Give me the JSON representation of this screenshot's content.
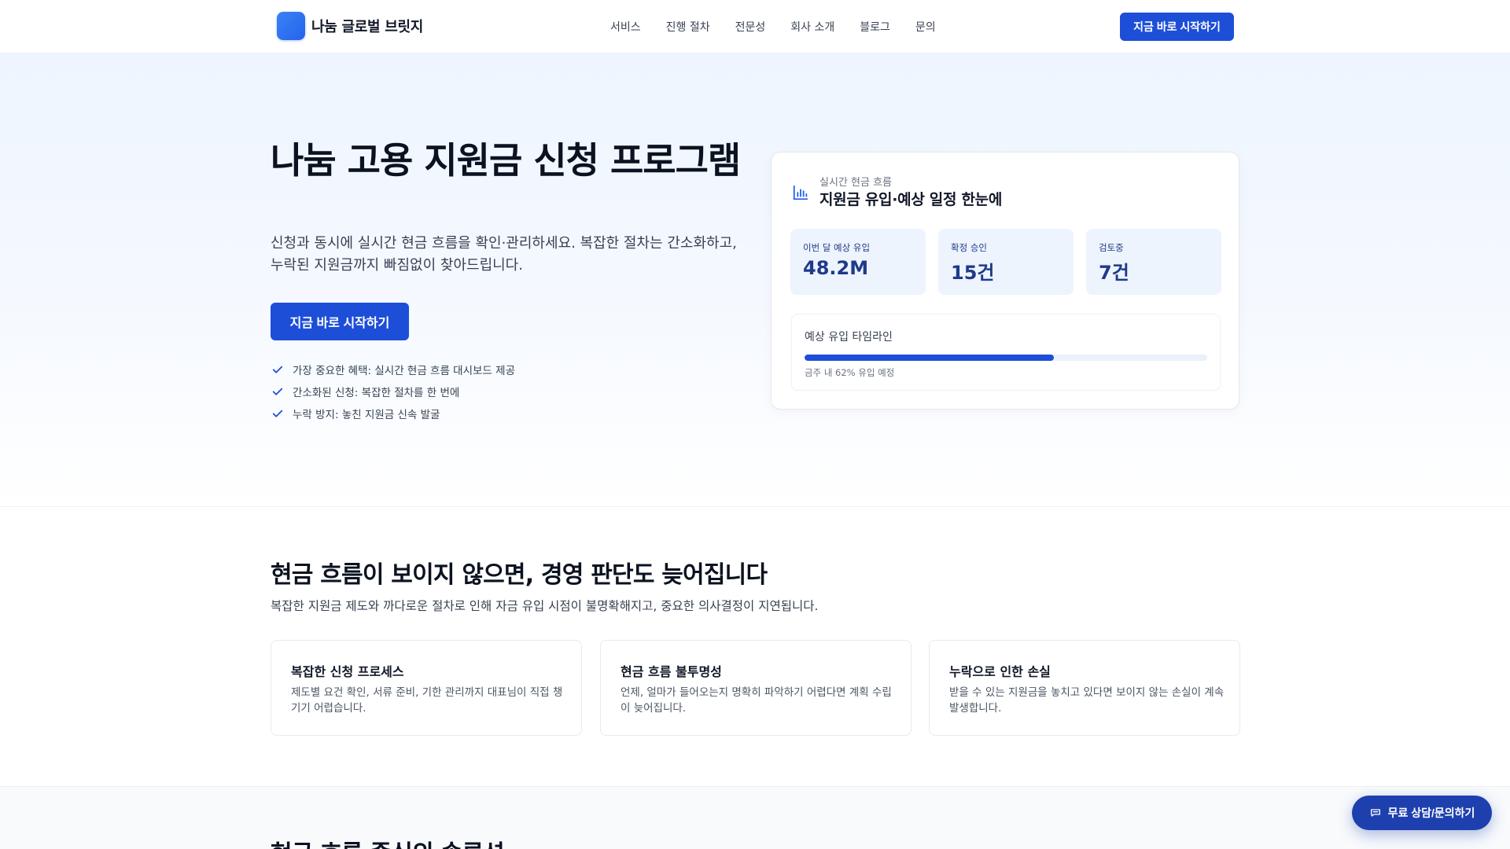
{
  "header": {
    "brand": "나눔 글로벌 브릿지",
    "nav": [
      "서비스",
      "진행 절차",
      "전문성",
      "회사 소개",
      "블로그",
      "문의"
    ],
    "cta_label": "지금 바로 시작하기"
  },
  "hero": {
    "title": "나눔 고용 지원금 신청 프로그램",
    "description": "신청과 동시에 실시간 현금 흐름을 확인·관리하세요. 복잡한 절차는 간소화하고, 누락된 지원금까지 빠짐없이 찾아드립니다.",
    "cta_label": "지금 바로 시작하기",
    "benefits": [
      "가장 중요한 혜택: 실시간 현금 흐름 대시보드 제공",
      "간소화된 신청: 복잡한 절차를 한 번에",
      "누락 방지: 놓친 지원금 신속 발굴"
    ]
  },
  "dashboard": {
    "icon": "bar-chart-icon",
    "subtitle": "실시간 현금 흐름",
    "title": "지원금 유입·예상 일정 한눈에",
    "stats": [
      {
        "label": "이번 달 예상 유입",
        "value": "48.2M"
      },
      {
        "label": "확정 승인",
        "value": "15건"
      },
      {
        "label": "검토중",
        "value": "7건"
      }
    ],
    "timeline": {
      "label": "예상 유입 타임라인",
      "progress_percent": 62,
      "note": "금주 내 62% 유입 예정"
    }
  },
  "problem": {
    "title": "현금 흐름이 보이지 않으면, 경영 판단도 늦어집니다",
    "description": "복잡한 지원금 제도와 까다로운 절차로 인해 자금 유입 시점이 불명확해지고, 중요한 의사결정이 지연됩니다.",
    "cards": [
      {
        "title": "복잡한 신청 프로세스",
        "body": "제도별 요건 확인, 서류 준비, 기한 관리까지 대표님이 직접 챙기기 어렵습니다."
      },
      {
        "title": "현금 흐름 불투명성",
        "body": "언제, 얼마가 들어오는지 명확히 파악하기 어렵다면 계획 수립이 늦어집니다."
      },
      {
        "title": "누락으로 인한 손실",
        "body": "받을 수 있는 지원금을 놓치고 있다면 보이지 않는 손실이 계속 발생합니다."
      }
    ]
  },
  "next_section": {
    "title": "현금 흐름 중심의 솔루션"
  },
  "floating": {
    "label": "무료 상담/문의하기",
    "icon": "chat-icon"
  },
  "colors": {
    "primary": "#1d4ed8",
    "stat_bg": "#eef4fd",
    "stat_text": "#1e3a8a"
  }
}
